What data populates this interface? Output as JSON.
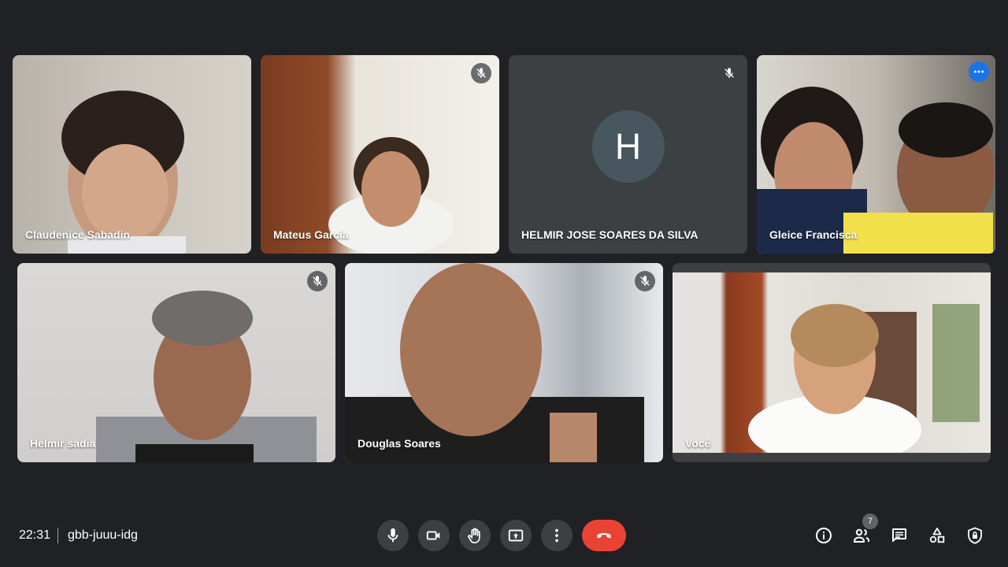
{
  "participants": [
    {
      "name": "Claudenice Sabadin"
    },
    {
      "name": "Mateus Garcia"
    },
    {
      "name": "HELMIR JOSE SOARES DA SILVA",
      "avatar_letter": "H"
    },
    {
      "name": "Gleice Francisca"
    },
    {
      "name": "Helmir sadia"
    },
    {
      "name": "Douglas Soares"
    },
    {
      "name": "Você"
    }
  ],
  "bottom_bar": {
    "time": "22:31",
    "meeting_code": "gbb-juuu-idg",
    "participant_count": "7"
  },
  "icons": {
    "controls": [
      "mic-icon",
      "camera-icon",
      "raise-hand-icon",
      "present-icon",
      "more-options-icon",
      "hang-up-icon"
    ],
    "right": [
      "info-icon",
      "people-icon",
      "chat-icon",
      "activities-icon",
      "host-controls-icon"
    ]
  },
  "colors": {
    "background": "#202124",
    "hangup": "#ea4335",
    "pin_border": "#8ab4f8",
    "more_button": "#1a73e8",
    "avatar": "#47565f"
  }
}
